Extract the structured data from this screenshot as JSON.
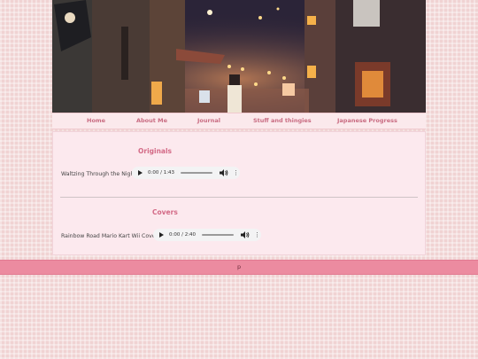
{
  "nav": {
    "items": [
      {
        "label": "Home"
      },
      {
        "label": "About Me"
      },
      {
        "label": "Journal"
      },
      {
        "label": "Stuff and thingies"
      },
      {
        "label": "Japanese Progress"
      }
    ]
  },
  "sections": [
    {
      "title": "Originals",
      "tracks": [
        {
          "name": "Waltzing Through the Night",
          "time": "0:00 / 1:43",
          "progress": 0
        }
      ]
    },
    {
      "title": "Covers",
      "tracks": [
        {
          "name": "Rainbow Road Mario Kart Wii Cover",
          "time": "0:00 / 2:40",
          "progress": 0
        }
      ]
    }
  ],
  "player_icons": [
    "play-icon",
    "volume-icon",
    "more-options-icon"
  ],
  "footer": {
    "text": "p"
  },
  "colors": {
    "accent": "#d36a86",
    "nav_text": "#c96c82",
    "footer_bg": "#ec8ba0",
    "content_bg": "#fce9ee"
  }
}
